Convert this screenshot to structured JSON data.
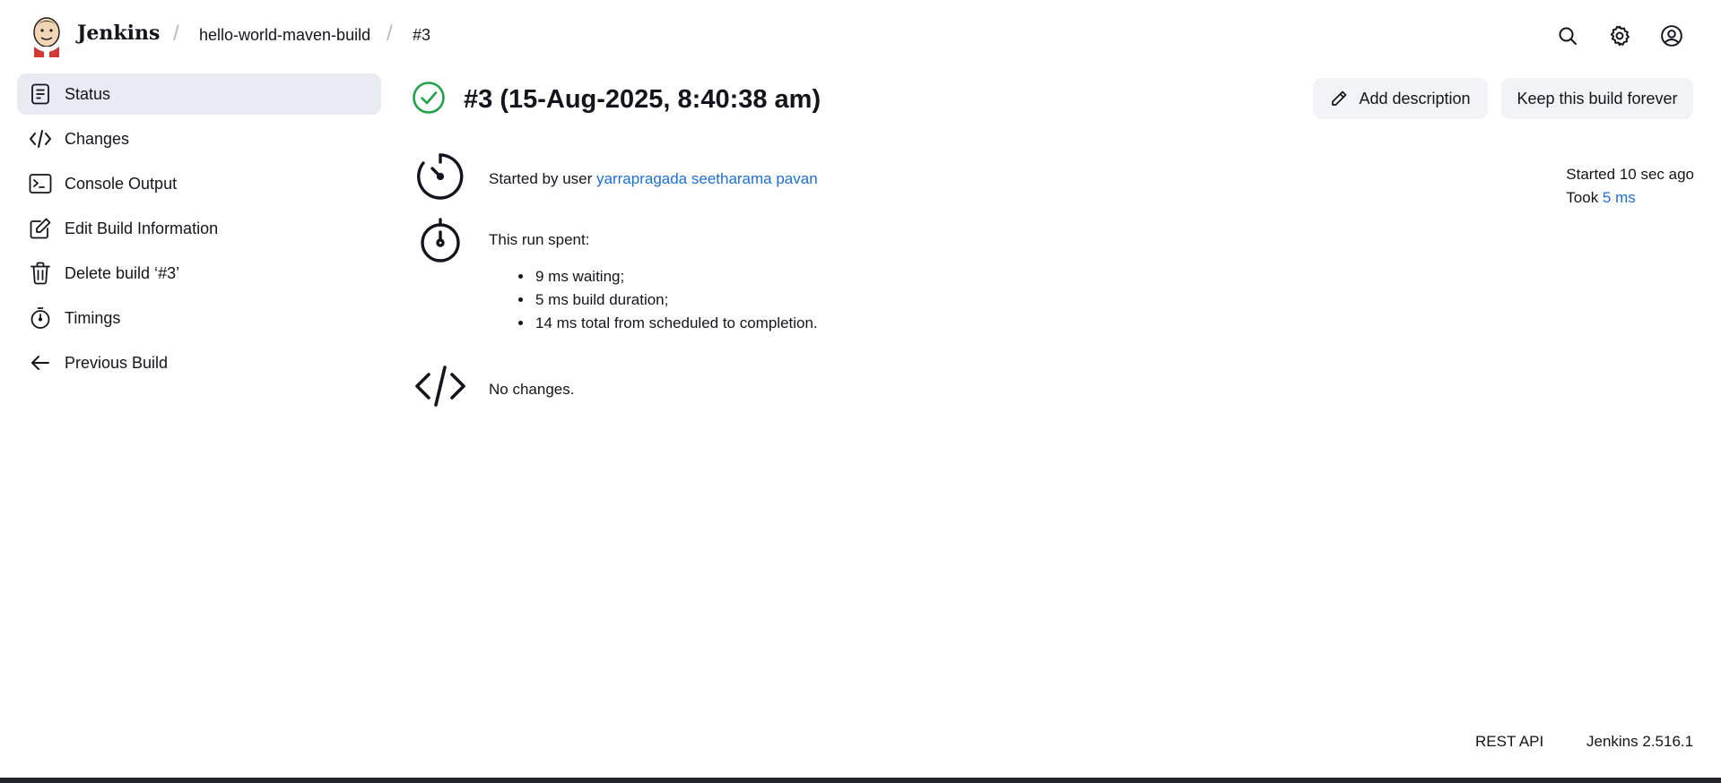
{
  "header": {
    "brand": "Jenkins",
    "breadcrumbs": [
      "hello-world-maven-build",
      "#3"
    ],
    "icons": [
      "search-icon",
      "gear-icon",
      "user-icon"
    ]
  },
  "sidebar": {
    "items": [
      {
        "label": "Status",
        "icon": "document-icon",
        "active": true
      },
      {
        "label": "Changes",
        "icon": "code-icon"
      },
      {
        "label": "Console Output",
        "icon": "terminal-icon"
      },
      {
        "label": "Edit Build Information",
        "icon": "edit-icon"
      },
      {
        "label": "Delete build ‘#3’",
        "icon": "trash-icon"
      },
      {
        "label": "Timings",
        "icon": "stopwatch-icon"
      },
      {
        "label": "Previous Build",
        "icon": "arrow-left-icon"
      }
    ]
  },
  "main": {
    "title": "#3 (15-Aug-2025, 8:40:38 am)",
    "status_color": "#1ea446",
    "add_description_label": "Add description",
    "keep_forever_label": "Keep this build forever",
    "started_by_prefix": "Started by user ",
    "started_by_user": "yarrapragada seetharama pavan",
    "started_ago": "Started 10 sec ago",
    "took_prefix": "Took ",
    "took_value": "5 ms",
    "run_spent_label": "This run spent:",
    "run_spent_items": [
      "9 ms waiting;",
      "5 ms build duration;",
      "14 ms total from scheduled to completion."
    ],
    "no_changes": "No changes."
  },
  "footer": {
    "rest_api": "REST API",
    "version": "Jenkins 2.516.1"
  },
  "colors": {
    "link": "#1a6fdb",
    "active_bg": "#e8ecf2",
    "success": "#1ea446"
  }
}
